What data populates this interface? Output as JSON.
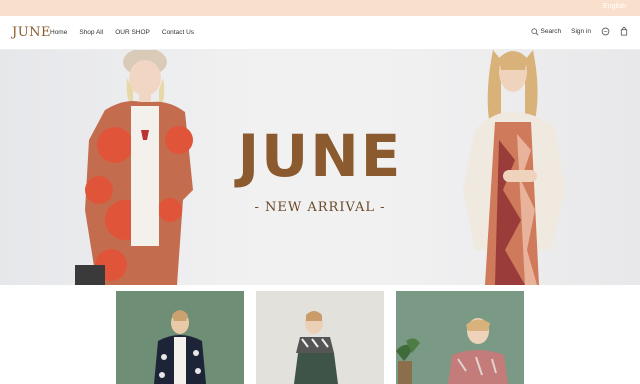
{
  "topbar": {
    "language": "English"
  },
  "header": {
    "logo": "JUNE",
    "nav": [
      "Home",
      "Shop All",
      "OUR SHOP",
      "Contact Us"
    ],
    "search_label": "Search",
    "signin_label": "Sign in"
  },
  "hero": {
    "title": "JUNE",
    "subtitle": "- NEW ARRIVAL -"
  },
  "colors": {
    "topbar": "#f9e0cc",
    "brand": "#8b5a2e"
  }
}
